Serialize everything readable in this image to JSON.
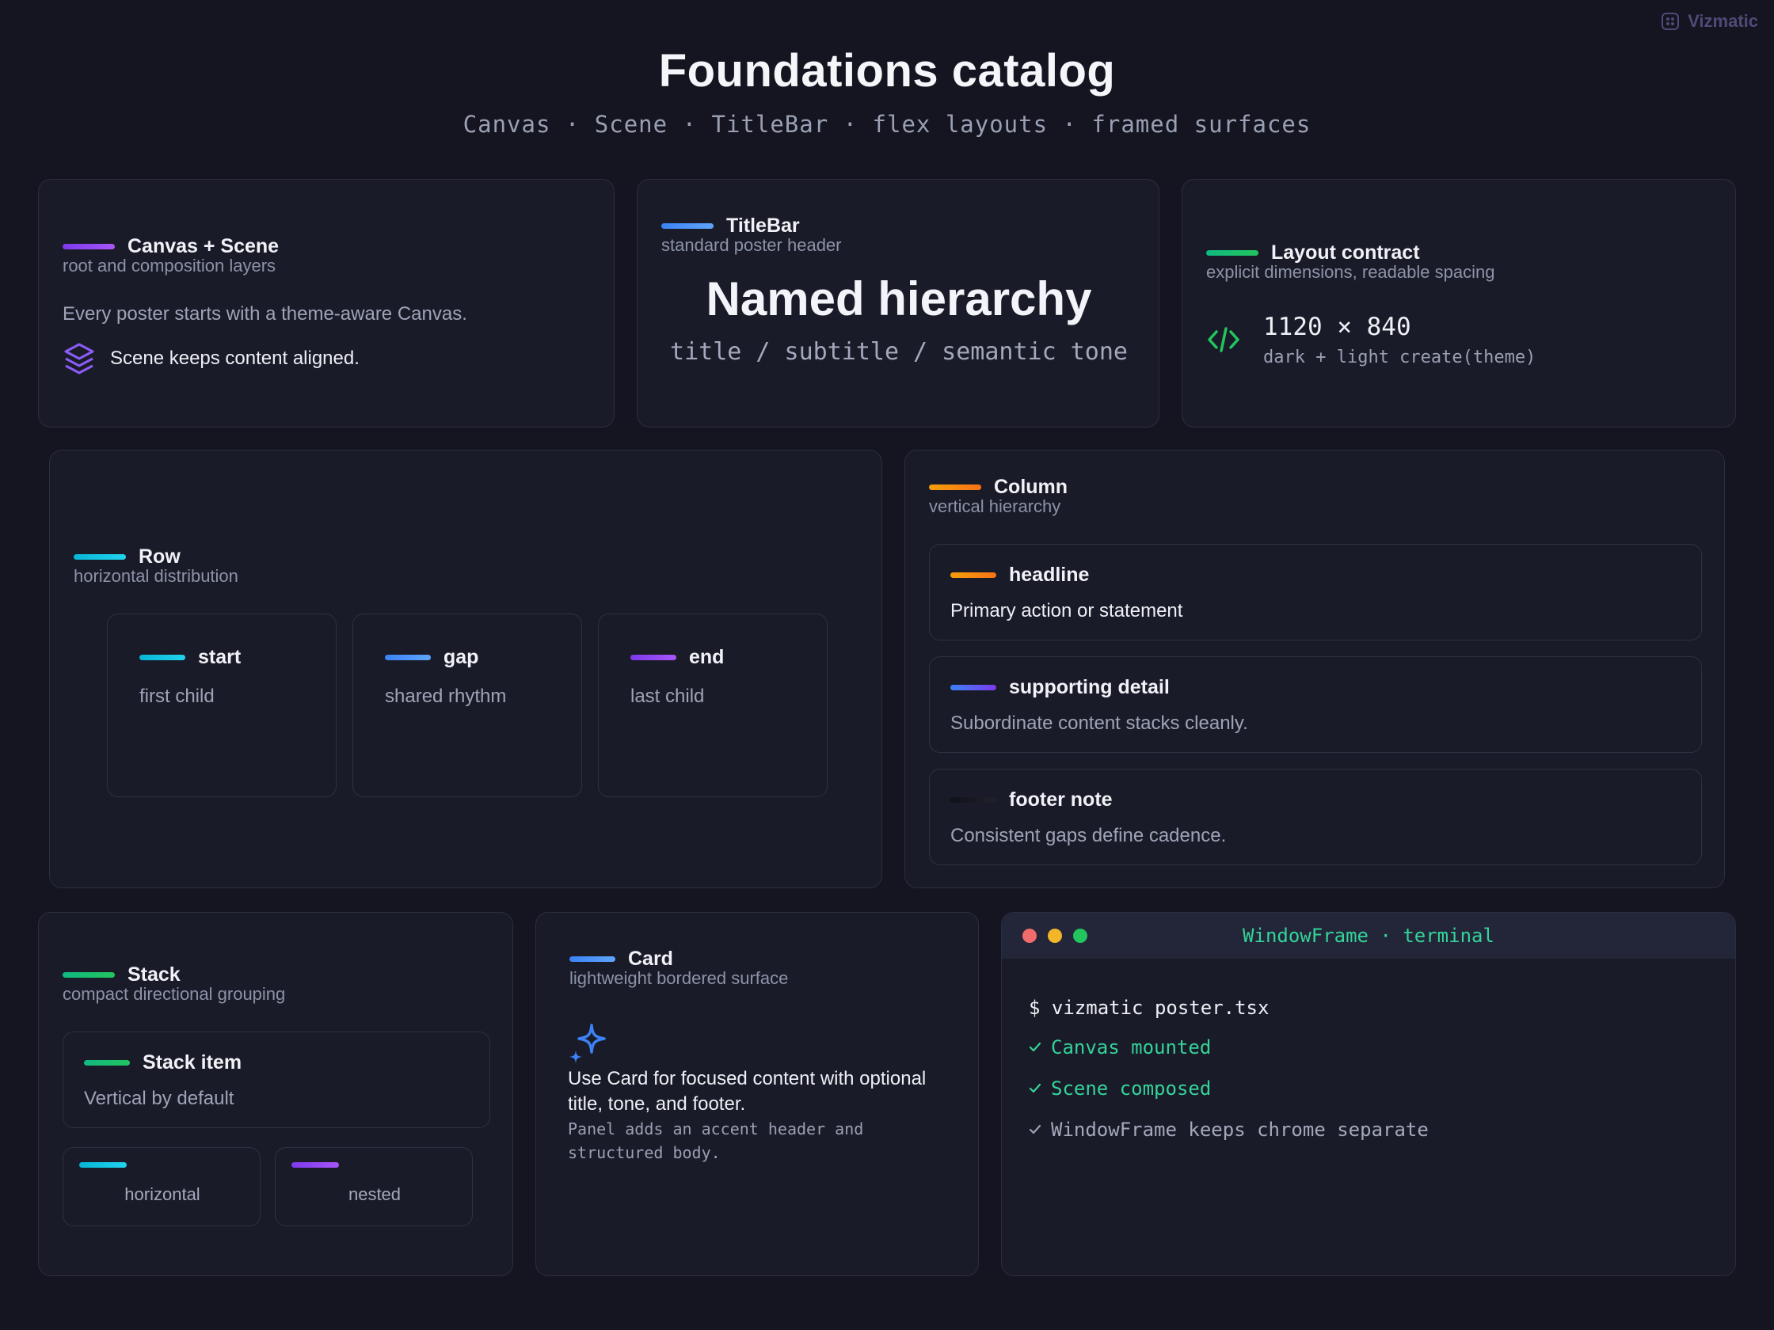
{
  "brand": {
    "name": "Vizmatic",
    "icon": "vizmatic-logo-icon"
  },
  "header": {
    "title": "Foundations catalog",
    "subtitle": "Canvas · Scene · TitleBar · flex layouts · framed surfaces"
  },
  "canvas_scene": {
    "title": "Canvas + Scene",
    "subtitle": "root and composition layers",
    "body": "Every poster starts with a theme-aware Canvas.",
    "note": "Scene keeps content aligned.",
    "icon": "layers-icon"
  },
  "titlebar": {
    "title": "TitleBar",
    "subtitle": "standard poster header",
    "headline": "Named hierarchy",
    "tagline": "title / subtitle / semantic tone"
  },
  "layout_contract": {
    "title": "Layout contract",
    "subtitle": "explicit dimensions, readable spacing",
    "dimensions": "1120 × 840",
    "detail": "dark + light create(theme)",
    "icon": "code-icon"
  },
  "row": {
    "title": "Row",
    "subtitle": "horizontal distribution",
    "items": [
      {
        "label": "start",
        "text": "first child"
      },
      {
        "label": "gap",
        "text": "shared rhythm"
      },
      {
        "label": "end",
        "text": "last child"
      }
    ]
  },
  "column": {
    "title": "Column",
    "subtitle": "vertical hierarchy",
    "items": [
      {
        "label": "headline",
        "text": "Primary action or statement"
      },
      {
        "label": "supporting detail",
        "text": "Subordinate content stacks cleanly."
      },
      {
        "label": "footer note",
        "text": "Consistent gaps define cadence."
      }
    ]
  },
  "stack": {
    "title": "Stack",
    "subtitle": "compact directional grouping",
    "item_title": "Stack item",
    "item_text": "Vertical by default",
    "chips": [
      "horizontal",
      "nested"
    ]
  },
  "card_demo": {
    "title": "Card",
    "subtitle": "lightweight bordered surface",
    "body": "Use Card for focused content with optional title, tone, and footer.",
    "note": "Panel adds an accent header and structured body.",
    "icon": "sparkle-icon"
  },
  "terminal": {
    "title": "WindowFrame · terminal",
    "command": "$ vizmatic poster.tsx",
    "lines": [
      "Canvas mounted",
      "Scene composed",
      "WindowFrame keeps chrome separate"
    ]
  },
  "colors": {
    "background": "#141520",
    "card": "#1a1b28",
    "border": "#2b2e40",
    "success": "#34d399",
    "accent_blue": "#3b82f6",
    "accent_purple": "#a855f7"
  }
}
